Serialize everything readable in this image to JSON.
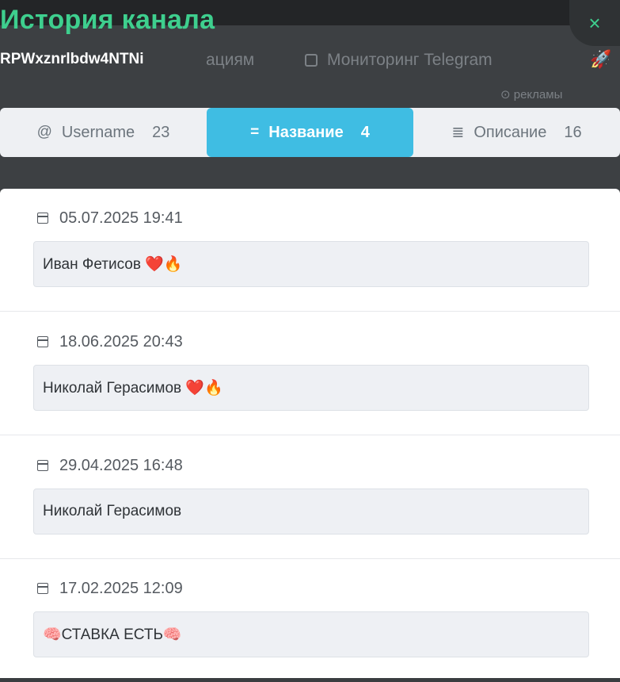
{
  "background": {
    "nav_item_1": "ациям",
    "nav_item_2": "Мониторинг Telegram",
    "sub_label": "рекламы"
  },
  "modal": {
    "title": "История канала",
    "subtitle": "RPWxznrlbdw4NTNi",
    "close_label": "×",
    "accent_color": "#3ecf8e",
    "active_tab_color": "#3fbde3"
  },
  "tabs": [
    {
      "icon": "@",
      "label": "Username",
      "count": "23",
      "active": false
    },
    {
      "icon": "=",
      "label": "Название",
      "count": "4",
      "active": true
    },
    {
      "icon": "≣",
      "label": "Описание",
      "count": "16",
      "active": false
    }
  ],
  "history": [
    {
      "date": "05.07.2025 19:41",
      "value": "Иван Фетисов ❤️🔥"
    },
    {
      "date": "18.06.2025 20:43",
      "value": "Николай Герасимов ❤️🔥"
    },
    {
      "date": "29.04.2025 16:48",
      "value": "Николай Герасимов"
    },
    {
      "date": "17.02.2025 12:09",
      "value": "🧠СТАВКА ЕСТЬ🧠"
    }
  ]
}
